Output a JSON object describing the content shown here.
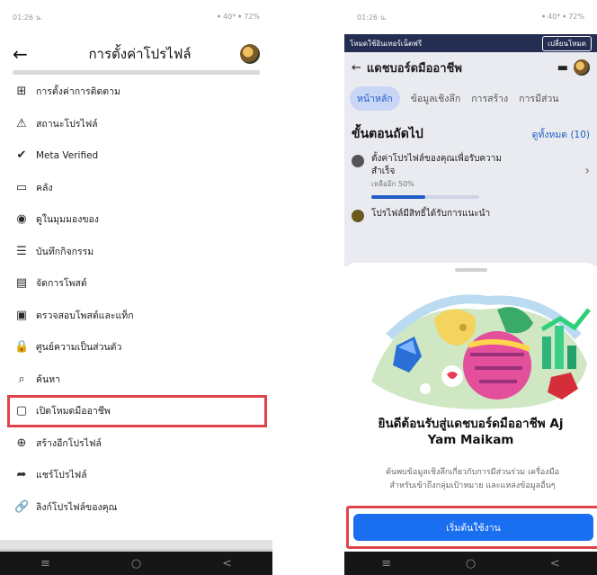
{
  "left": {
    "status": {
      "time": "01:26 น.",
      "right": "ꔷ 40* ꔷ 72%"
    },
    "header": {
      "title": "การตั้งค่าโปรไฟล์",
      "back_icon": "back-arrow-icon"
    },
    "menu": [
      {
        "label": "การตั้งค่าการติดตาม",
        "icon": "follow-settings-icon",
        "glyph": "⊞"
      },
      {
        "label": "สถานะโปรไฟล์",
        "icon": "warning-icon",
        "glyph": "⚠"
      },
      {
        "label": "Meta Verified",
        "icon": "verified-icon",
        "glyph": "✔"
      },
      {
        "label": "คลัง",
        "icon": "archive-icon",
        "glyph": "▭"
      },
      {
        "label": "ดูในมุมมองของ",
        "icon": "eye-icon",
        "glyph": "◉"
      },
      {
        "label": "บันทึกกิจกรรม",
        "icon": "activity-log-icon",
        "glyph": "☰"
      },
      {
        "label": "จัดการโพสต์",
        "icon": "manage-posts-icon",
        "glyph": "▤"
      },
      {
        "label": "ตรวจสอบโพสต์และแท็ก",
        "icon": "review-posts-icon",
        "glyph": "▣"
      },
      {
        "label": "ศูนย์ความเป็นส่วนตัว",
        "icon": "lock-icon",
        "glyph": "🔒"
      },
      {
        "label": "ค้นหา",
        "icon": "search-icon",
        "glyph": "⌕"
      },
      {
        "label": "เปิดโหมดมืออาชีพ",
        "icon": "professional-mode-icon",
        "glyph": "▢",
        "highlighted": true
      },
      {
        "label": "สร้างอีกโปรไฟล์",
        "icon": "plus-circle-icon",
        "glyph": "⊕"
      },
      {
        "label": "แชร์โปรไฟล์",
        "icon": "share-icon",
        "glyph": "➦"
      },
      {
        "label": "ลิงก์โปรไฟล์ของคุณ",
        "icon": "link-icon",
        "glyph": "🔗"
      }
    ],
    "nav": {
      "menu": "≡",
      "home": "○",
      "back": "<"
    }
  },
  "right": {
    "status": {
      "time": "01:26 น.",
      "right": "ꔷ 40* ꔷ 72%"
    },
    "switchbar": {
      "text": "โหมดใช้อินเทอร์เน็ตฟรี",
      "button": "เปลี่ยนโหมด"
    },
    "header": {
      "title": "แดชบอร์ดมืออาชีพ"
    },
    "tabs": [
      "หน้าหลัก",
      "ข้อมูลเชิงลึก",
      "การสร้าง",
      "การมีส่วน"
    ],
    "steps": {
      "title": "ขั้นตอนถัดไป",
      "see_all": "ดูทั้งหมด (10)",
      "items": [
        {
          "text": "ตั้งค่าโปรไฟล์ของคุณเพื่อรับความสำเร็จ",
          "sub": "เหลืออีก 50%",
          "progress": 0.5
        },
        {
          "text": "โปรไฟล์มีสิทธิ์ได้รับการแนะนำ"
        }
      ]
    },
    "sheet": {
      "welcome": "ยินดีต้อนรับสู่แดชบอร์ดมืออาชีพ Aj Yam Maikam",
      "description": "ค้นพบข้อมูลเชิงลึกเกี่ยวกับการมีส่วนร่วม เครื่องมือสำหรับเข้าถึงกลุ่มเป้าหมาย และแหล่งข้อมูลอื่นๆ",
      "button": "เริ่มต้นใช้งาน"
    },
    "nav": {
      "menu": "≡",
      "home": "○",
      "back": "<"
    }
  },
  "colors": {
    "accent_blue": "#1a6ef0",
    "highlight_red": "#e0444b",
    "dark_bar": "#242e52"
  }
}
